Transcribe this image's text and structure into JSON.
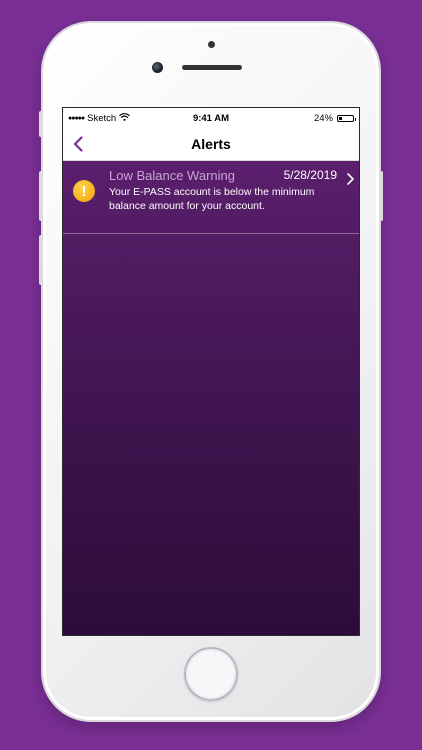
{
  "status_bar": {
    "carrier": "Sketch",
    "time": "9:41 AM",
    "battery": "24%",
    "battery_level": 0.24
  },
  "nav": {
    "title": "Alerts"
  },
  "alerts": [
    {
      "title": "Low Balance Warning",
      "date": "5/28/2019",
      "body": "Your E-PASS account is below the minimum balance amount for your account."
    }
  ],
  "colors": {
    "background": "#7a2f95",
    "accent": "#7a2f95",
    "warning": "#f6b119"
  },
  "icons": {
    "back": "chevron-left-icon",
    "alert": "warning-icon",
    "disclosure": "chevron-right-icon",
    "wifi": "wifi-icon",
    "battery": "battery-icon"
  }
}
